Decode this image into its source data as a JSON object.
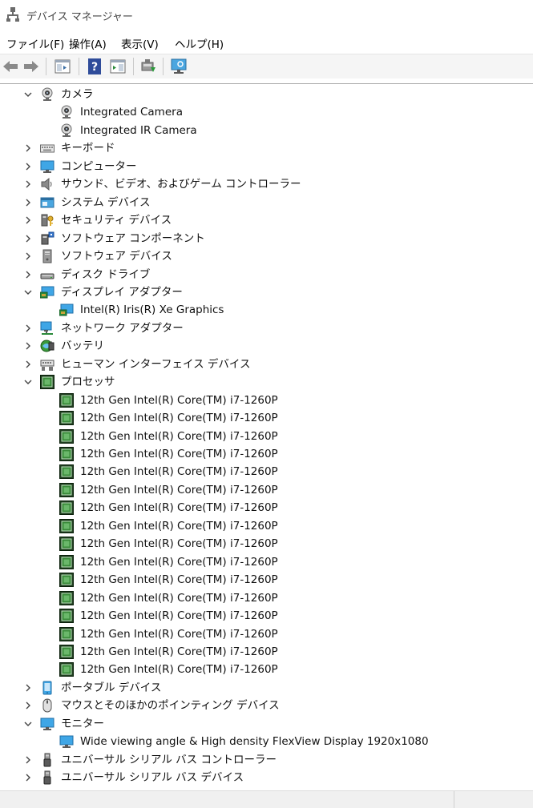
{
  "window": {
    "title": "デバイス マネージャー"
  },
  "menu": [
    "ファイル(F)",
    "操作(A)",
    "表示(V)",
    "ヘルプ(H)"
  ],
  "toolbar": {
    "buttons": [
      {
        "name": "back-button",
        "icon": "arrow-left-icon"
      },
      {
        "name": "forward-button",
        "icon": "arrow-right-icon"
      },
      {
        "name": "show-hide-console-tree-button",
        "icon": "console-tree-icon"
      },
      {
        "name": "help-button",
        "icon": "help-icon"
      },
      {
        "name": "properties-button",
        "icon": "properties-icon"
      },
      {
        "name": "update-driver-button",
        "icon": "update-driver-icon"
      },
      {
        "name": "scan-hardware-button",
        "icon": "scan-hardware-icon"
      }
    ]
  },
  "tree": [
    {
      "label": "カメラ",
      "level": 0,
      "expanded": true,
      "icon": "camera"
    },
    {
      "label": "Integrated Camera",
      "level": 1,
      "icon": "camera"
    },
    {
      "label": "Integrated IR Camera",
      "level": 1,
      "icon": "camera"
    },
    {
      "label": "キーボード",
      "level": 0,
      "expanded": false,
      "icon": "keyboard"
    },
    {
      "label": "コンピューター",
      "level": 0,
      "expanded": false,
      "icon": "monitor"
    },
    {
      "label": "サウンド、ビデオ、およびゲーム コントローラー",
      "level": 0,
      "expanded": false,
      "icon": "speaker"
    },
    {
      "label": "システム デバイス",
      "level": 0,
      "expanded": false,
      "icon": "system"
    },
    {
      "label": "セキュリティ デバイス",
      "level": 0,
      "expanded": false,
      "icon": "security"
    },
    {
      "label": "ソフトウェア コンポーネント",
      "level": 0,
      "expanded": false,
      "icon": "software-component"
    },
    {
      "label": "ソフトウェア デバイス",
      "level": 0,
      "expanded": false,
      "icon": "software-device"
    },
    {
      "label": "ディスク ドライブ",
      "level": 0,
      "expanded": false,
      "icon": "disk"
    },
    {
      "label": "ディスプレイ アダプター",
      "level": 0,
      "expanded": true,
      "icon": "display-adapter"
    },
    {
      "label": "Intel(R) Iris(R) Xe Graphics",
      "level": 1,
      "icon": "display-adapter"
    },
    {
      "label": "ネットワーク アダプター",
      "level": 0,
      "expanded": false,
      "icon": "network"
    },
    {
      "label": "バッテリ",
      "level": 0,
      "expanded": false,
      "icon": "battery"
    },
    {
      "label": "ヒューマン インターフェイス デバイス",
      "level": 0,
      "expanded": false,
      "icon": "hid"
    },
    {
      "label": "プロセッサ",
      "level": 0,
      "expanded": true,
      "icon": "processor"
    },
    {
      "label": "12th Gen Intel(R) Core(TM) i7-1260P",
      "level": 1,
      "icon": "processor"
    },
    {
      "label": "12th Gen Intel(R) Core(TM) i7-1260P",
      "level": 1,
      "icon": "processor"
    },
    {
      "label": "12th Gen Intel(R) Core(TM) i7-1260P",
      "level": 1,
      "icon": "processor"
    },
    {
      "label": "12th Gen Intel(R) Core(TM) i7-1260P",
      "level": 1,
      "icon": "processor"
    },
    {
      "label": "12th Gen Intel(R) Core(TM) i7-1260P",
      "level": 1,
      "icon": "processor"
    },
    {
      "label": "12th Gen Intel(R) Core(TM) i7-1260P",
      "level": 1,
      "icon": "processor"
    },
    {
      "label": "12th Gen Intel(R) Core(TM) i7-1260P",
      "level": 1,
      "icon": "processor"
    },
    {
      "label": "12th Gen Intel(R) Core(TM) i7-1260P",
      "level": 1,
      "icon": "processor"
    },
    {
      "label": "12th Gen Intel(R) Core(TM) i7-1260P",
      "level": 1,
      "icon": "processor"
    },
    {
      "label": "12th Gen Intel(R) Core(TM) i7-1260P",
      "level": 1,
      "icon": "processor"
    },
    {
      "label": "12th Gen Intel(R) Core(TM) i7-1260P",
      "level": 1,
      "icon": "processor"
    },
    {
      "label": "12th Gen Intel(R) Core(TM) i7-1260P",
      "level": 1,
      "icon": "processor"
    },
    {
      "label": "12th Gen Intel(R) Core(TM) i7-1260P",
      "level": 1,
      "icon": "processor"
    },
    {
      "label": "12th Gen Intel(R) Core(TM) i7-1260P",
      "level": 1,
      "icon": "processor"
    },
    {
      "label": "12th Gen Intel(R) Core(TM) i7-1260P",
      "level": 1,
      "icon": "processor"
    },
    {
      "label": "12th Gen Intel(R) Core(TM) i7-1260P",
      "level": 1,
      "icon": "processor"
    },
    {
      "label": "ポータブル デバイス",
      "level": 0,
      "expanded": false,
      "icon": "portable"
    },
    {
      "label": "マウスとそのほかのポインティング デバイス",
      "level": 0,
      "expanded": false,
      "icon": "mouse"
    },
    {
      "label": "モニター",
      "level": 0,
      "expanded": true,
      "icon": "monitor"
    },
    {
      "label": "Wide viewing angle & High density FlexView Display 1920x1080",
      "level": 1,
      "icon": "monitor"
    },
    {
      "label": "ユニバーサル シリアル バス コントローラー",
      "level": 0,
      "expanded": false,
      "icon": "usb"
    },
    {
      "label": "ユニバーサル シリアル バス デバイス",
      "level": 0,
      "expanded": false,
      "icon": "usb"
    }
  ]
}
